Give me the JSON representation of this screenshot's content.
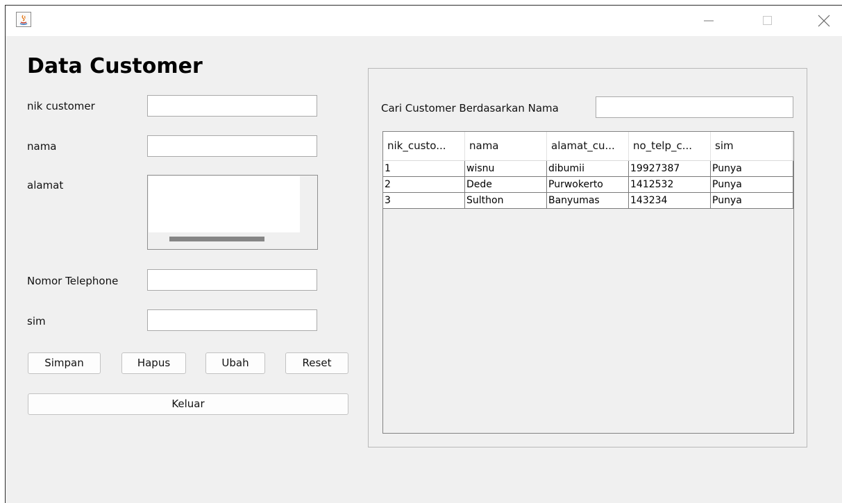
{
  "window": {
    "controls": {
      "minimize": "—",
      "maximize": "☐",
      "close": "✕"
    }
  },
  "form": {
    "title": "Data Customer",
    "labels": {
      "nik": "nik customer",
      "nama": "nama",
      "alamat": "alamat",
      "telepon": "Nomor Telephone",
      "sim": "sim"
    },
    "values": {
      "nik": "",
      "nama": "",
      "alamat": "",
      "telepon": "",
      "sim": ""
    },
    "buttons": {
      "simpan": "Simpan",
      "hapus": "Hapus",
      "ubah": "Ubah",
      "reset": "Reset",
      "keluar": "Keluar"
    }
  },
  "search": {
    "label": "Cari Customer Berdasarkan Nama",
    "value": ""
  },
  "table": {
    "columns": [
      "nik_custo...",
      "nama",
      "alamat_cu...",
      "no_telp_c...",
      "sim"
    ],
    "rows": [
      [
        "1",
        "wisnu",
        "dibumii",
        "19927387",
        "Punya"
      ],
      [
        "2",
        "Dede",
        "Purwokerto",
        "1412532",
        "Punya"
      ],
      [
        "3",
        "Sulthon",
        "Banyumas",
        "143234",
        "Punya"
      ]
    ]
  }
}
